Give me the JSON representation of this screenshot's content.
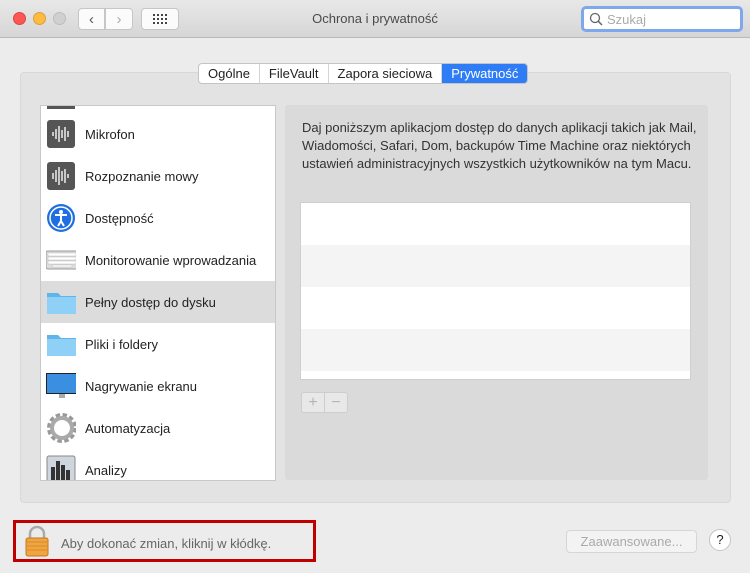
{
  "window": {
    "title": "Ochrona i prywatność",
    "search_placeholder": "Szukaj"
  },
  "tabs": [
    "Ogólne",
    "FileVault",
    "Zapora sieciowa",
    "Prywatność"
  ],
  "active_tab": "Prywatność",
  "list": [
    {
      "label": "Mikrofon",
      "icon": "microphone-icon"
    },
    {
      "label": "Rozpoznanie mowy",
      "icon": "speech-recognition-icon"
    },
    {
      "label": "Dostępność",
      "icon": "accessibility-icon"
    },
    {
      "label": "Monitorowanie wprowadzania",
      "icon": "keyboard-icon"
    },
    {
      "label": "Pełny dostęp do dysku",
      "icon": "folder-icon",
      "selected": true
    },
    {
      "label": "Pliki i foldery",
      "icon": "folder-icon"
    },
    {
      "label": "Nagrywanie ekranu",
      "icon": "display-icon"
    },
    {
      "label": "Automatyzacja",
      "icon": "gear-icon"
    },
    {
      "label": "Analizy",
      "icon": "analytics-icon"
    }
  ],
  "panel": {
    "description": "Daj poniższym aplikacjom dostęp do danych aplikacji takich jak Mail, Wiadomości, Safari, Dom, backupów Time Machine oraz niektórych ustawień administracyjnych wszystkich użytkowników na tym Macu.",
    "add": "+",
    "remove": "−"
  },
  "footer": {
    "lock_text": "Aby dokonać zmian, kliknij w kłódkę.",
    "advanced": "Zaawansowane...",
    "help": "?"
  },
  "colors": {
    "accent": "#2f7df6",
    "highlight": "#c00000"
  }
}
